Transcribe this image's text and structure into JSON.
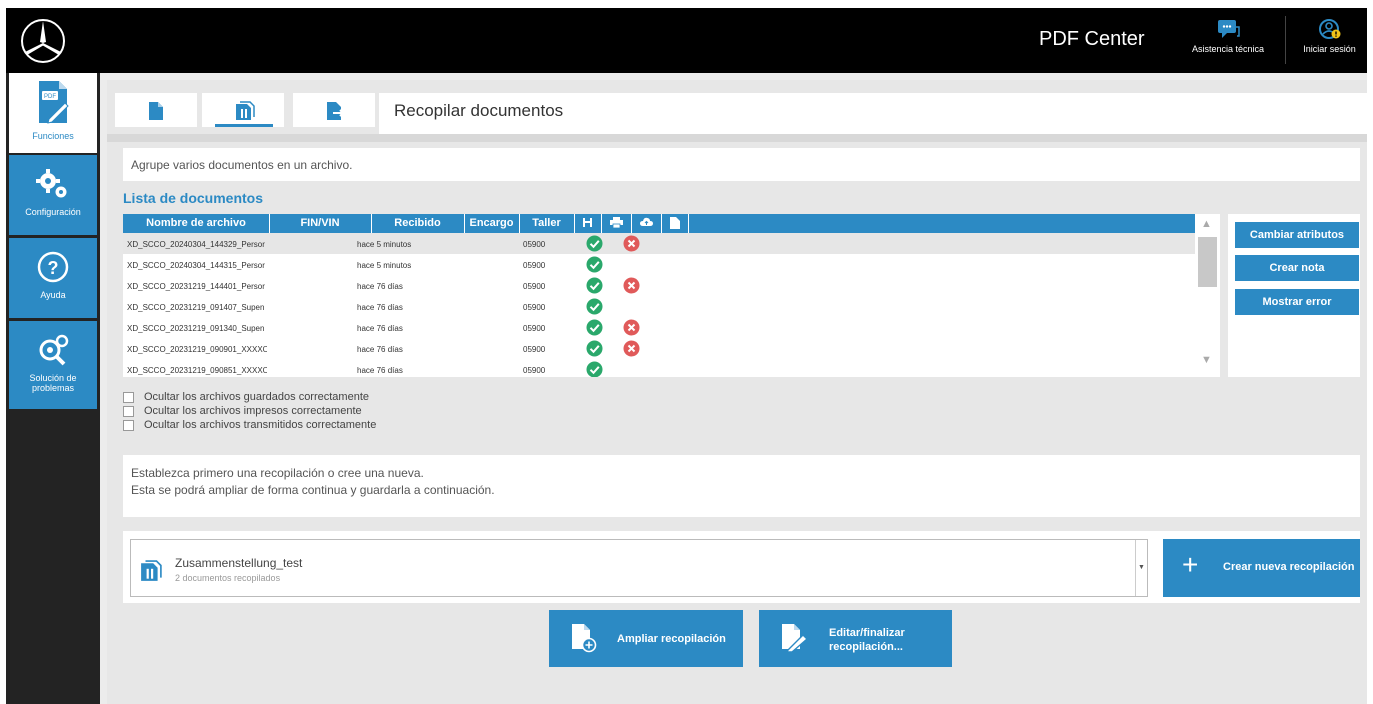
{
  "header": {
    "app_title": "PDF Center",
    "support_label": "Asistencia técnica",
    "login_label": "Iniciar sesión",
    "support_icon": "chat-icon",
    "login_icon": "user-icon"
  },
  "sidebar": {
    "items": [
      {
        "label": "Funciones",
        "icon": "pdf-icon",
        "active": true
      },
      {
        "label": "Configuración",
        "icon": "gears-icon"
      },
      {
        "label": "Ayuda",
        "icon": "help-icon"
      },
      {
        "label": "Solución de problemas",
        "icon": "troubleshoot-icon"
      }
    ]
  },
  "tabs": {
    "items": [
      {
        "icon": "document-icon"
      },
      {
        "icon": "collect-documents-icon",
        "active": true
      },
      {
        "icon": "export-document-icon"
      }
    ]
  },
  "page": {
    "title": "Recopilar documentos",
    "description": "Agrupe varios documentos en un archivo.",
    "list_heading": "Lista de documentos"
  },
  "table": {
    "columns": {
      "name": "Nombre de archivo",
      "fin": "FIN/VIN",
      "received": "Recibido",
      "order": "Encargo",
      "workshop": "Taller",
      "saved_icon": "save-icon",
      "print_icon": "print-icon",
      "upload_icon": "cloud-upload-icon",
      "file_icon": "file-icon"
    },
    "rows": [
      {
        "name": "XD_SCCO_20240304_144329_Persor",
        "received": "hace 5 minutos",
        "workshop": "05900",
        "saved": true,
        "printed": false
      },
      {
        "name": "XD_SCCO_20240304_144315_Persor",
        "received": "hace 5 minutos",
        "workshop": "05900",
        "saved": true,
        "printed": null
      },
      {
        "name": "XD_SCCO_20231219_144401_Persor",
        "received": "hace 76 días",
        "workshop": "05900",
        "saved": true,
        "printed": false
      },
      {
        "name": "XD_SCCO_20231219_091407_Supen",
        "received": "hace 76 días",
        "workshop": "05900",
        "saved": true,
        "printed": null
      },
      {
        "name": "XD_SCCO_20231219_091340_Supen",
        "received": "hace 76 días",
        "workshop": "05900",
        "saved": true,
        "printed": false
      },
      {
        "name": "XD_SCCO_20231219_090901_XXXXO",
        "received": "hace 76 días",
        "workshop": "05900",
        "saved": true,
        "printed": false
      },
      {
        "name": "XD_SCCO_20231219_090851_XXXXO",
        "received": "hace 76 días",
        "workshop": "05900",
        "saved": true,
        "printed": null
      }
    ]
  },
  "actions": {
    "change_attributes": "Cambiar atributos",
    "create_note": "Crear nota",
    "show_error": "Mostrar error"
  },
  "filters": [
    {
      "label": "Ocultar los archivos guardados correctamente",
      "checked": false
    },
    {
      "label": "Ocultar los archivos impresos correctamente",
      "checked": false
    },
    {
      "label": "Ocultar los archivos transmitidos correctamente",
      "checked": false
    }
  ],
  "info": {
    "line1": "Establezca primero una recopilación o cree una nueva.",
    "line2": "Esta se podrá ampliar de forma continua y guardarla a continuación."
  },
  "collection": {
    "name": "Zusammenstellung_test",
    "count": "2 documentos recopilados",
    "new_button": "Crear nueva recopilación"
  },
  "bottom": {
    "extend_button": "Ampliar recopilación",
    "edit_button_line1": "Editar/finalizar",
    "edit_button_line2": "recopilación..."
  },
  "colors": {
    "accent": "#2c8ac4",
    "success": "#2aa86b",
    "error": "#e05a5a",
    "topbar": "#000000",
    "sidebar": "#232323"
  }
}
